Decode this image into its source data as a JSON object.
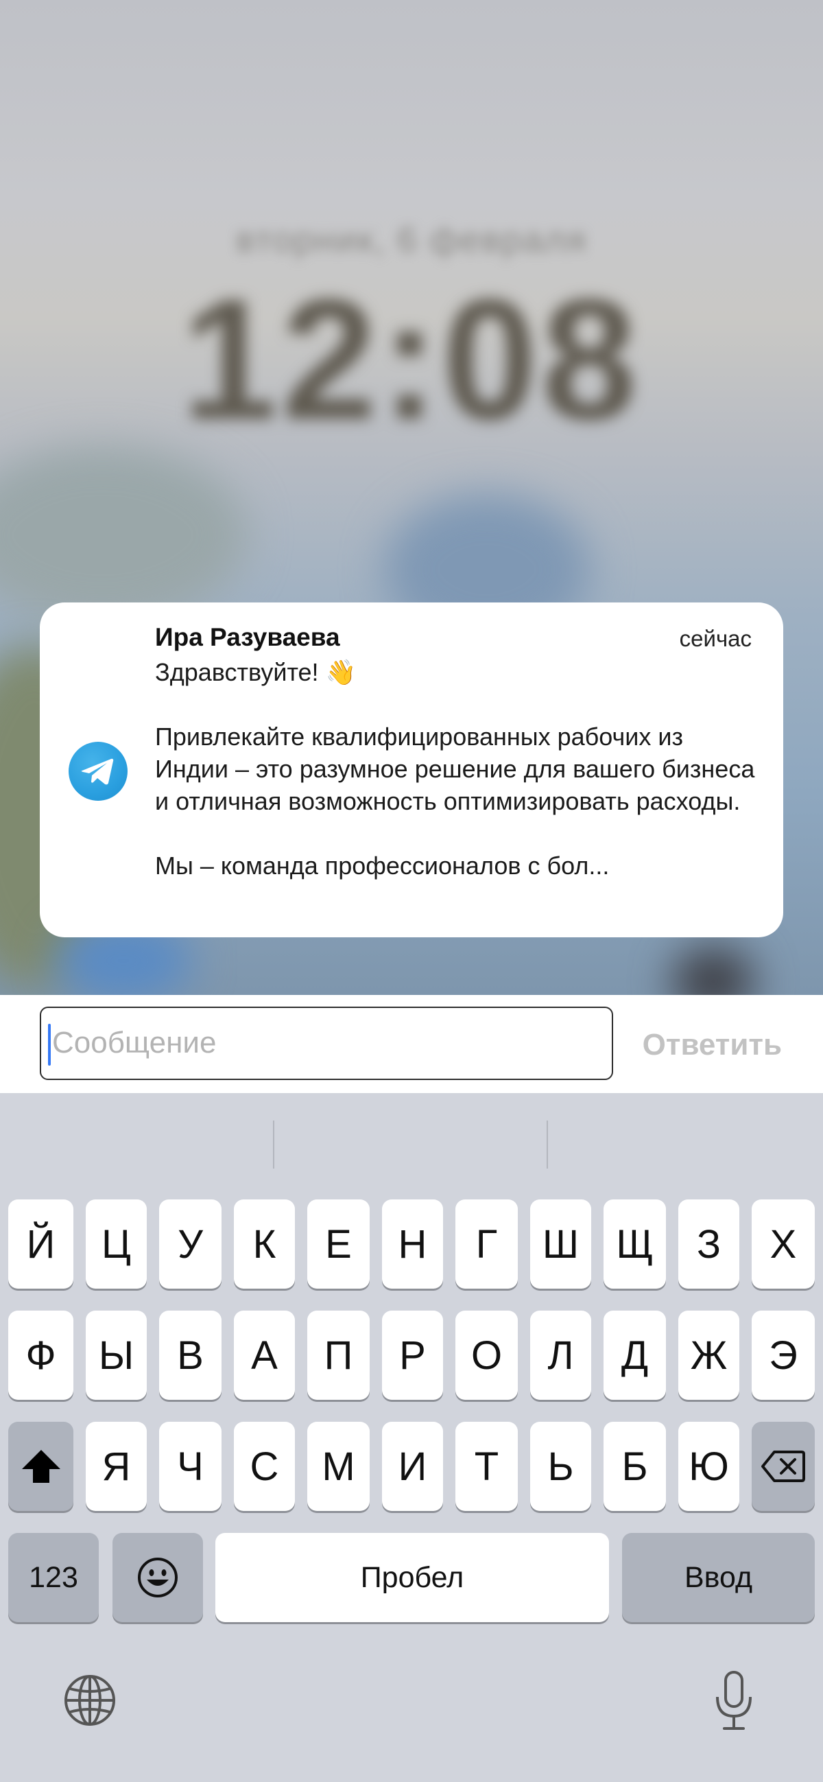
{
  "lockscreen": {
    "date": "вторник, 6 февраля",
    "time": "12:08"
  },
  "notification": {
    "app_icon": "telegram-icon",
    "sender": "Ира Разуваева",
    "time": "сейчас",
    "greeting": "Здравствуйте! 👋",
    "paragraph1": "Привлекайте квалифицированных рабочих из Индии – это разумное решение для вашего бизнеса и отличная возможность оптимизировать расходы.",
    "paragraph2": "Мы – команда профессионалов с бол..."
  },
  "reply": {
    "placeholder": "Сообщение",
    "button": "Ответить",
    "accent": "#3478f6"
  },
  "keyboard": {
    "row1": [
      "Й",
      "Ц",
      "У",
      "К",
      "Е",
      "Н",
      "Г",
      "Ш",
      "Щ",
      "З",
      "Х"
    ],
    "row2": [
      "Ф",
      "Ы",
      "В",
      "А",
      "П",
      "Р",
      "О",
      "Л",
      "Д",
      "Ж",
      "Э"
    ],
    "row3": [
      "Я",
      "Ч",
      "С",
      "М",
      "И",
      "Т",
      "Ь",
      "Б",
      "Ю"
    ],
    "numbers": "123",
    "space": "Пробел",
    "enter": "Ввод",
    "shift_icon": "shift-icon",
    "delete_icon": "delete-icon",
    "emoji_icon": "emoji-icon",
    "globe_icon": "globe-icon",
    "mic_icon": "microphone-icon"
  }
}
